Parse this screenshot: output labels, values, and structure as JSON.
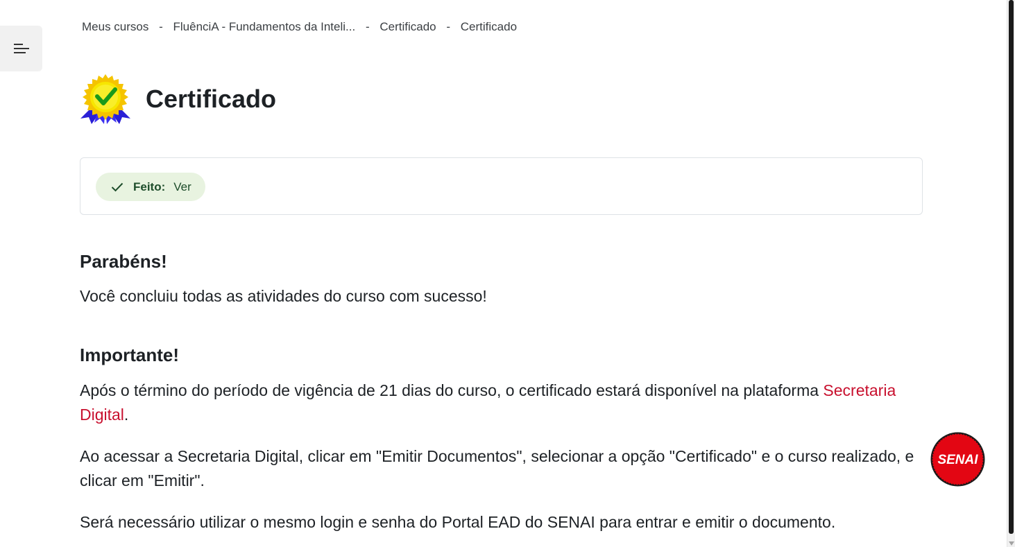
{
  "breadcrumb": {
    "items": [
      "Meus cursos",
      "FluênciA - Fundamentos da Inteli...",
      "Certificado",
      "Certificado"
    ],
    "separator": "-"
  },
  "header": {
    "title": "Certificado",
    "icon": "certificate-seal-icon"
  },
  "completion": {
    "label": "Feito:",
    "value": "Ver",
    "icon": "check-icon",
    "color_bg": "#e8f3e0",
    "color_text": "#1e4d2b"
  },
  "content": {
    "congrats_heading": "Parabéns!",
    "congrats_text": "Você concluiu todas as atividades do curso com sucesso!",
    "important_heading": "Importante!",
    "para1_before": "Após o término do período de vigência de 21 dias do curso, o certificado estará disponível na plataforma ",
    "para1_link": "Secretaria Digital",
    "para1_after": ".",
    "para2": "Ao acessar a Secretaria Digital, clicar em \"Emitir Documentos\", selecionar a opção \"Certificado\" e o curso realizado, e clicar em \"Emitir\".",
    "para3": "Será necessário utilizar o mesmo login e senha do Portal EAD do SENAI para entrar e emitir o documento."
  },
  "floating_badge": {
    "text": "SENAI",
    "color": "#e30613"
  },
  "colors": {
    "link": "#c8102e",
    "text": "#1d2125"
  }
}
